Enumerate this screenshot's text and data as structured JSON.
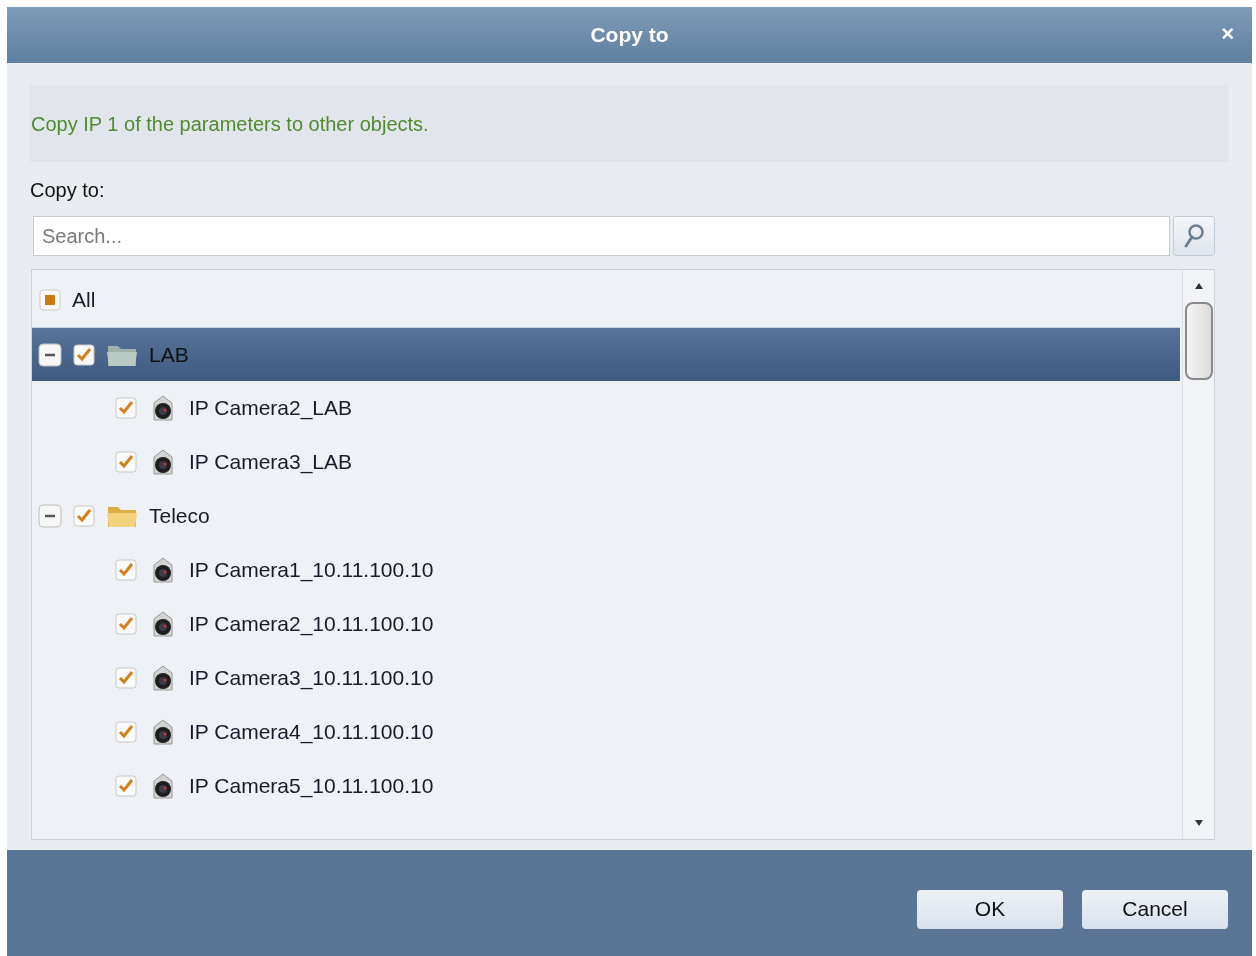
{
  "dialog": {
    "title": "Copy to",
    "close": "×"
  },
  "message": "Copy IP 1 of the parameters to other objects.",
  "copy_to_label": "Copy to:",
  "search": {
    "placeholder": "Search..."
  },
  "tree": {
    "all": {
      "label": "All",
      "checked": false,
      "partial": true,
      "selected": false
    },
    "groups": [
      {
        "label": "LAB",
        "expanded": true,
        "checked": true,
        "selected": true,
        "children": [
          {
            "label": "IP Camera2_LAB",
            "checked": true,
            "selected": false
          },
          {
            "label": "IP Camera3_LAB",
            "checked": true,
            "selected": false
          }
        ]
      },
      {
        "label": "Teleco",
        "expanded": true,
        "checked": true,
        "selected": false,
        "children": [
          {
            "label": "IP Camera1_10.11.100.10",
            "checked": true,
            "selected": false
          },
          {
            "label": "IP Camera2_10.11.100.10",
            "checked": true,
            "selected": false
          },
          {
            "label": "IP Camera3_10.11.100.10",
            "checked": true,
            "selected": false
          },
          {
            "label": "IP Camera4_10.11.100.10",
            "checked": true,
            "selected": false
          },
          {
            "label": "IP Camera5_10.11.100.10",
            "checked": true,
            "selected": false
          }
        ]
      }
    ]
  },
  "buttons": [
    "OK",
    "Cancel"
  ]
}
